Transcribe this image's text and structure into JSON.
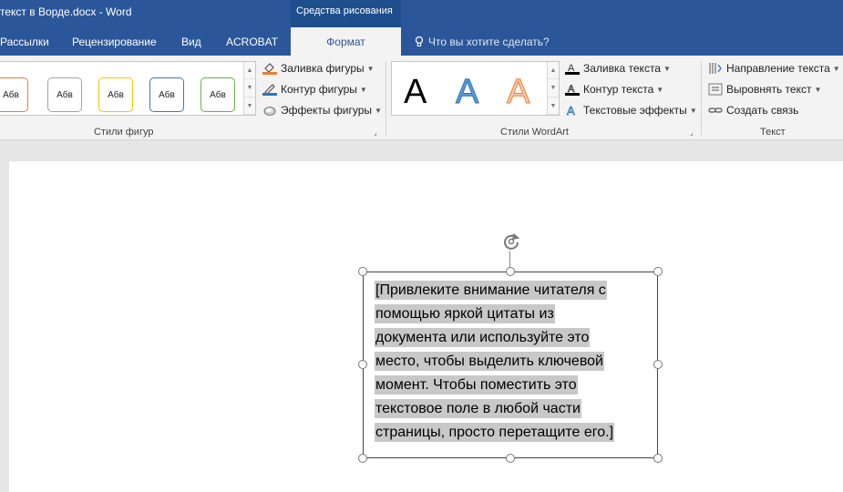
{
  "window": {
    "title": "текст в Ворде.docx - Word",
    "context_tab": "Средства рисования"
  },
  "tabs": [
    {
      "label": "Рассылки"
    },
    {
      "label": "Рецензирование"
    },
    {
      "label": "Вид"
    },
    {
      "label": "ACROBAT"
    },
    {
      "label": "Формат",
      "active": true
    }
  ],
  "tell_me": "Что вы хотите сделать?",
  "ribbon": {
    "shape_styles": {
      "label": "Стили фигур",
      "swatches": [
        {
          "text": "Абв",
          "border": "#ed7d31"
        },
        {
          "text": "Абв",
          "border": "#a5a5a5"
        },
        {
          "text": "Абв",
          "border": "#ffc000"
        },
        {
          "text": "Абв",
          "border": "#4472c4"
        },
        {
          "text": "Абв",
          "border": "#70ad47"
        }
      ],
      "commands": [
        {
          "label": "Заливка фигуры",
          "icon": "paint-bucket-icon"
        },
        {
          "label": "Контур фигуры",
          "icon": "pen-outline-icon"
        },
        {
          "label": "Эффекты фигуры",
          "icon": "shape-effects-icon"
        }
      ]
    },
    "wordart": {
      "label": "Стили WordArt",
      "samples": [
        {
          "text": "A",
          "fill": "#000000"
        },
        {
          "text": "A",
          "fill": "#5b9bd5"
        },
        {
          "text": "A",
          "fill": "#f4b183"
        }
      ],
      "commands": [
        {
          "label": "Заливка текста",
          "icon": "text-fill-icon"
        },
        {
          "label": "Контур текста",
          "icon": "text-outline-icon"
        },
        {
          "label": "Текстовые эффекты",
          "icon": "text-effects-icon"
        }
      ]
    },
    "text": {
      "label": "Текст",
      "commands": [
        {
          "label": "Направление текста",
          "icon": "text-direction-icon"
        },
        {
          "label": "Выровнять текст",
          "icon": "align-text-icon"
        },
        {
          "label": "Создать связь",
          "icon": "link-icon"
        }
      ]
    }
  },
  "textbox": {
    "lines": [
      "[Привлеките внимание читателя с",
      "помощью яркой цитаты из",
      "документа или используйте это",
      "место, чтобы выделить ключевой",
      "момент. Чтобы поместить это",
      "текстовое поле в любой части",
      "страницы, просто перетащите его.]"
    ]
  },
  "colors": {
    "accent": "#2b579a",
    "selection": "#c8c8c8"
  }
}
